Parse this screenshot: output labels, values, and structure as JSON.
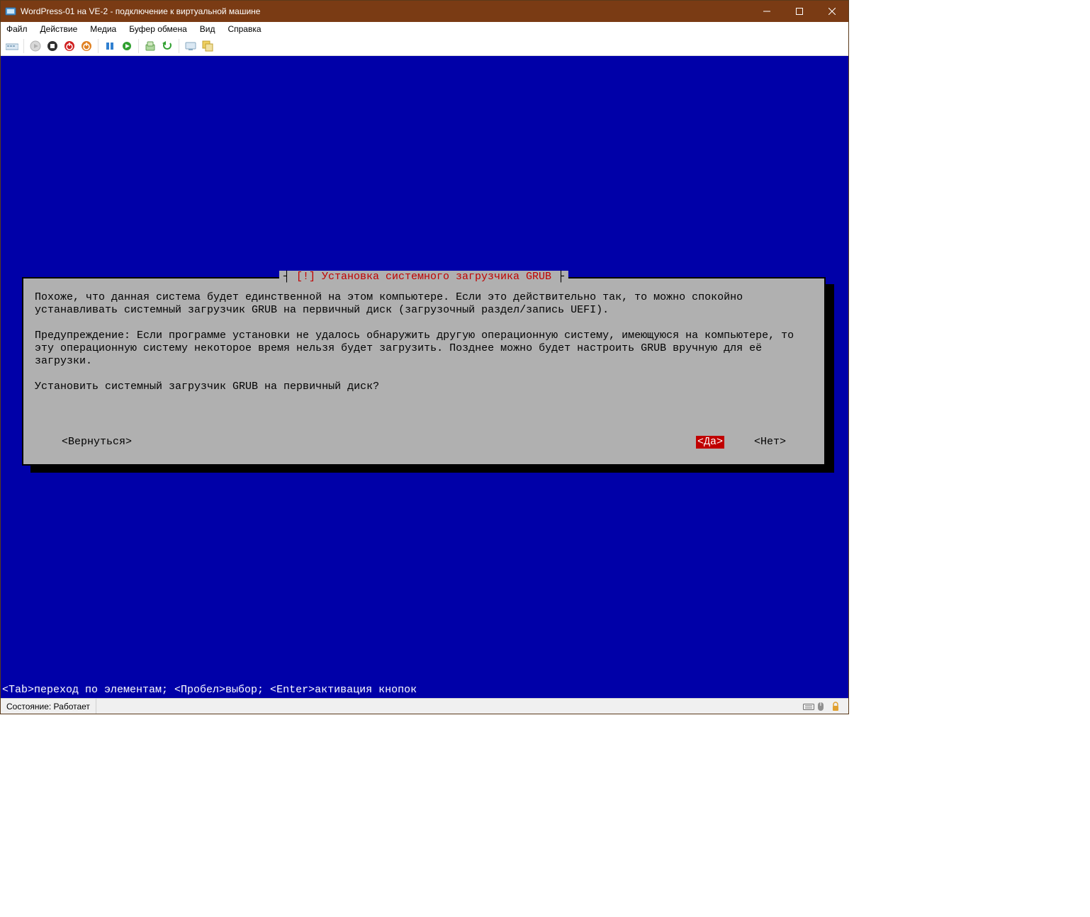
{
  "window": {
    "title": "WordPress-01 на VE-2 - подключение к виртуальной машине"
  },
  "menu": {
    "file": "Файл",
    "action": "Действие",
    "media": "Медиа",
    "clipboard": "Буфер обмена",
    "view": "Вид",
    "help": "Справка"
  },
  "dialog": {
    "bang": "[!]",
    "title": "Установка системного загрузчика GRUB",
    "para1": "Похоже, что данная система будет единственной на этом компьютере. Если это действительно так, то можно спокойно устанавливать системный загрузчик GRUB на первичный диск (загрузочный раздел/запись UEFI).",
    "para2": "Предупреждение: Если программе установки не удалось обнаружить другую операционную систему, имеющуюся на компьютере, то эту операционную систему некоторое время нельзя будет загрузить. Позднее можно будет настроить GRUB вручную для её загрузки.",
    "question": "Установить системный загрузчик GRUB на первичный диск?",
    "back": "<Вернуться>",
    "yes": "<Да>",
    "no": "<Нет>"
  },
  "hint": "<Tab>переход по элементам; <Пробел>выбор; <Enter>активация кнопок",
  "status": {
    "label": "Состояние: Работает"
  }
}
